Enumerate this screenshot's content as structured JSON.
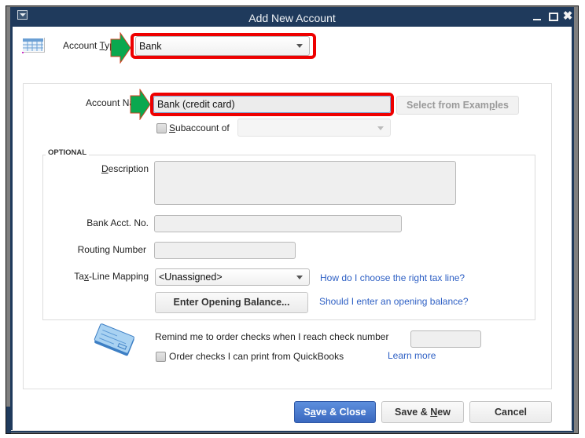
{
  "window": {
    "title": "Add New Account",
    "controls": [
      "minimize",
      "maximize",
      "close"
    ]
  },
  "account_type": {
    "label_prefix": "Account ",
    "label_underlined": "T",
    "label_suffix": "yp",
    "selected": "Bank",
    "icon": "table-grid-icon"
  },
  "account_name": {
    "label": "Account Na",
    "label_tail": "e",
    "value": "Bank (credit card)",
    "select_examples_prefix": "Select from Exam",
    "select_examples_underlined": "p",
    "select_examples_suffix": "les"
  },
  "subaccount": {
    "checked": false,
    "label_underlined": "S",
    "label_rest": "ubaccount of",
    "selected": ""
  },
  "optional": {
    "section_label": "OPTIONAL",
    "description": {
      "label_underlined": "D",
      "label_rest": "escription",
      "value": ""
    },
    "bank_acct_no": {
      "label": "Bank Acct. No.",
      "value": ""
    },
    "routing_number": {
      "label": "Routing Number",
      "value": ""
    },
    "tax_line": {
      "label_prefix": "Ta",
      "label_underlined": "x",
      "label_suffix": "-Line Mapping",
      "selected": "<Unassigned>",
      "help_link": "How do I choose the right tax line?"
    },
    "opening_balance": {
      "button_prefix": "Enter Openin",
      "button_underlined": "g",
      "button_suffix": " Balance...",
      "help_link": "Should I enter an opening balance?"
    }
  },
  "checks": {
    "icon": "check-book-icon",
    "remind_label": "Remind me to order checks when I reach check number",
    "check_number": "",
    "order_label": "Order checks I can print from QuickBooks",
    "order_checked": false,
    "learn_more": "Learn more"
  },
  "footer": {
    "save_close_prefix": "S",
    "save_close_underlined": "a",
    "save_close_suffix": "ve & Close",
    "save_new_prefix": "Save & ",
    "save_new_underlined": "N",
    "save_new_suffix": "ew",
    "cancel": "Cancel"
  },
  "colors": {
    "titlebar": "#1f3a5c",
    "annotation_red": "#ee0000",
    "annotation_green": "#0aa84f",
    "link": "#2d5fc4",
    "primary_button": "#3f72c9"
  }
}
